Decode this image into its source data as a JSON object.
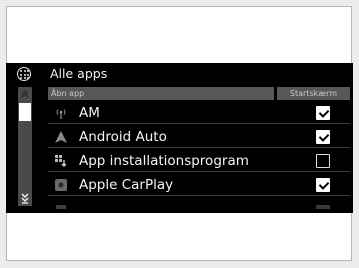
{
  "header": {
    "icon": "apps-grid-icon",
    "title": "Alle apps"
  },
  "columns": {
    "open_app": "Åbn app",
    "start_screen": "Startskærm"
  },
  "scrollbar": {
    "up_icon": "scroll-up-icon",
    "down_icon": "scroll-down-icon"
  },
  "apps": [
    {
      "icon": "radio-antenna-icon",
      "label": "AM",
      "checked": true
    },
    {
      "icon": "android-auto-icon",
      "label": "Android Auto",
      "checked": true
    },
    {
      "icon": "app-installer-icon",
      "label": "App installationsprogram",
      "checked": false
    },
    {
      "icon": "apple-carplay-icon",
      "label": "Apple CarPlay",
      "checked": true
    }
  ]
}
